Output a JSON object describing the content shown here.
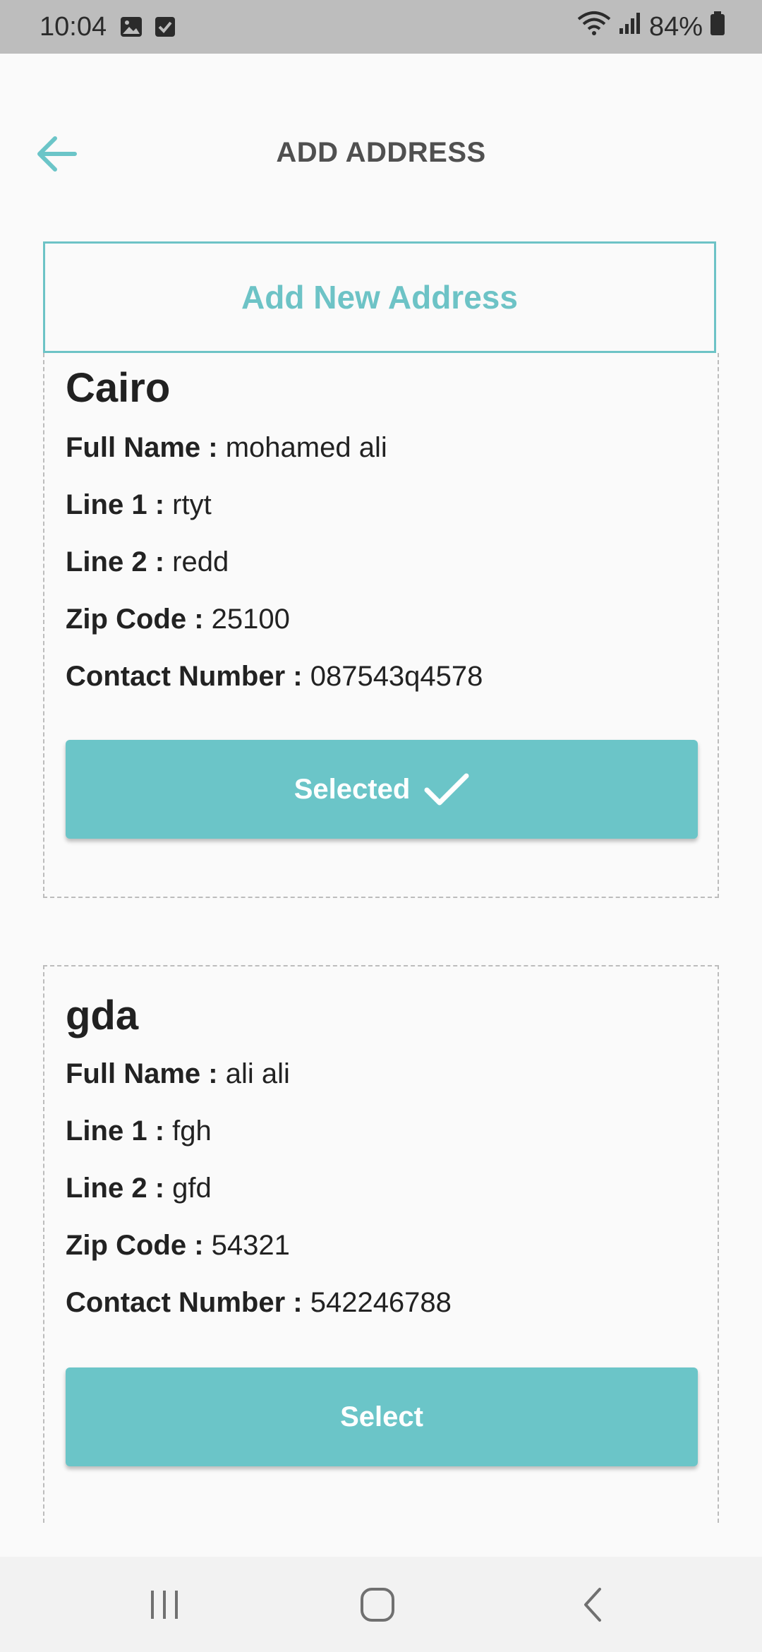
{
  "status_bar": {
    "time": "10:04",
    "battery": "84%",
    "icons": [
      "gallery-icon",
      "checkbox-icon",
      "wifi-icon",
      "signal-icon",
      "battery-icon"
    ]
  },
  "header": {
    "title": "ADD ADDRESS",
    "back_icon": "arrow-left-icon"
  },
  "add_new_label": "Add New Address",
  "addresses": [
    {
      "city": "Cairo",
      "fields": [
        {
          "label": "Full Name :",
          "value": "mohamed ali"
        },
        {
          "label": "Line 1 :",
          "value": "rtyt"
        },
        {
          "label": "Line 2 :",
          "value": "redd"
        },
        {
          "label": "Zip Code :",
          "value": "25100"
        },
        {
          "label": "Contact Number :",
          "value": "087543q4578"
        }
      ],
      "button_label": "Selected",
      "selected": true
    },
    {
      "city": "gda",
      "fields": [
        {
          "label": "Full Name :",
          "value": "ali ali"
        },
        {
          "label": "Line 1 :",
          "value": "fgh"
        },
        {
          "label": "Line 2 :",
          "value": "gfd"
        },
        {
          "label": "Zip Code :",
          "value": "54321"
        },
        {
          "label": "Contact Number :",
          "value": "542246788"
        }
      ],
      "button_label": "Select",
      "selected": false
    }
  ],
  "nav_bar": {
    "icons": [
      "recent-apps-icon",
      "home-icon",
      "back-icon"
    ]
  },
  "colors": {
    "accent": "#6bc5c8",
    "status_bar": "#bdbdbd",
    "background": "#fafafa"
  }
}
